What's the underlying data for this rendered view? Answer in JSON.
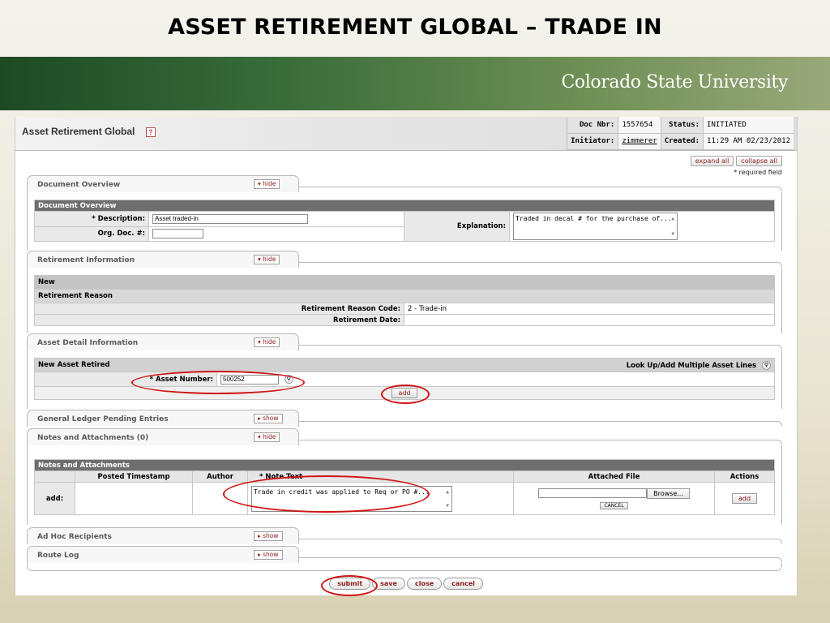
{
  "slide": {
    "title": "ASSET RETIREMENT GLOBAL – TRADE IN"
  },
  "banner": {
    "logo_text": "Colorado State University"
  },
  "header": {
    "title": "Asset Retirement Global",
    "help_icon": "help-icon",
    "doc_nbr_label": "Doc Nbr:",
    "doc_nbr": "1557654",
    "status_label": "Status:",
    "status": "INITIATED",
    "initiator_label": "Initiator:",
    "initiator": "zimmerer",
    "created_label": "Created:",
    "created": "11:29 AM 02/23/2012"
  },
  "top_controls": {
    "expand_all": "expand all",
    "collapse_all": "collapse all",
    "required_note": "* required field"
  },
  "tabs": {
    "document_overview": {
      "label": "Document Overview",
      "toggle": "▾ hide"
    },
    "retirement_information": {
      "label": "Retirement Information",
      "toggle": "▾ hide"
    },
    "asset_detail_information": {
      "label": "Asset Detail Information",
      "toggle": "▾ hide"
    },
    "general_ledger": {
      "label": "General Ledger Pending Entries",
      "toggle": "▸ show"
    },
    "notes_attachments": {
      "label": "Notes and Attachments (0)",
      "toggle": "▾ hide"
    },
    "ad_hoc": {
      "label": "Ad Hoc Recipients",
      "toggle": "▸ show"
    },
    "route_log": {
      "label": "Route Log",
      "toggle": "▸ show"
    }
  },
  "document_overview": {
    "section_header": "Document Overview",
    "description_label": "* Description:",
    "description_value": "Asset traded-in",
    "org_doc_label": "Org. Doc. #:",
    "org_doc_value": "",
    "explanation_label": "Explanation:",
    "explanation_value": "Traded in decal # for the purchase of..."
  },
  "retirement_information": {
    "new_label": "New",
    "reason_header": "Retirement Reason",
    "reason_code_label": "Retirement Reason Code:",
    "reason_code_value": "2 - Trade-in",
    "retirement_date_label": "Retirement Date:",
    "retirement_date_value": ""
  },
  "asset_detail": {
    "section_header": "New Asset Retired",
    "lookup_multiple": "Look Up/Add Multiple Asset Lines",
    "asset_number_label": "* Asset Number:",
    "asset_number_value": "500252",
    "add_label": "add"
  },
  "notes": {
    "section_header": "Notes and Attachments",
    "columns": [
      "Posted Timestamp",
      "Author",
      "* Note Text",
      "Attached File",
      "Actions"
    ],
    "add_row_label": "add:",
    "note_text_value": "Trade in credit was applied to Req or PO #...",
    "browse_label": "Browse...",
    "cancel_label": "CANCEL",
    "add_label": "add"
  },
  "bottom_buttons": {
    "submit": "submit",
    "save": "save",
    "close": "close",
    "cancel": "cancel"
  },
  "colors": {
    "annotation_red": "#d01414",
    "section_header_gray": "#6e6e6e",
    "link_red": "#8b1a1a"
  }
}
